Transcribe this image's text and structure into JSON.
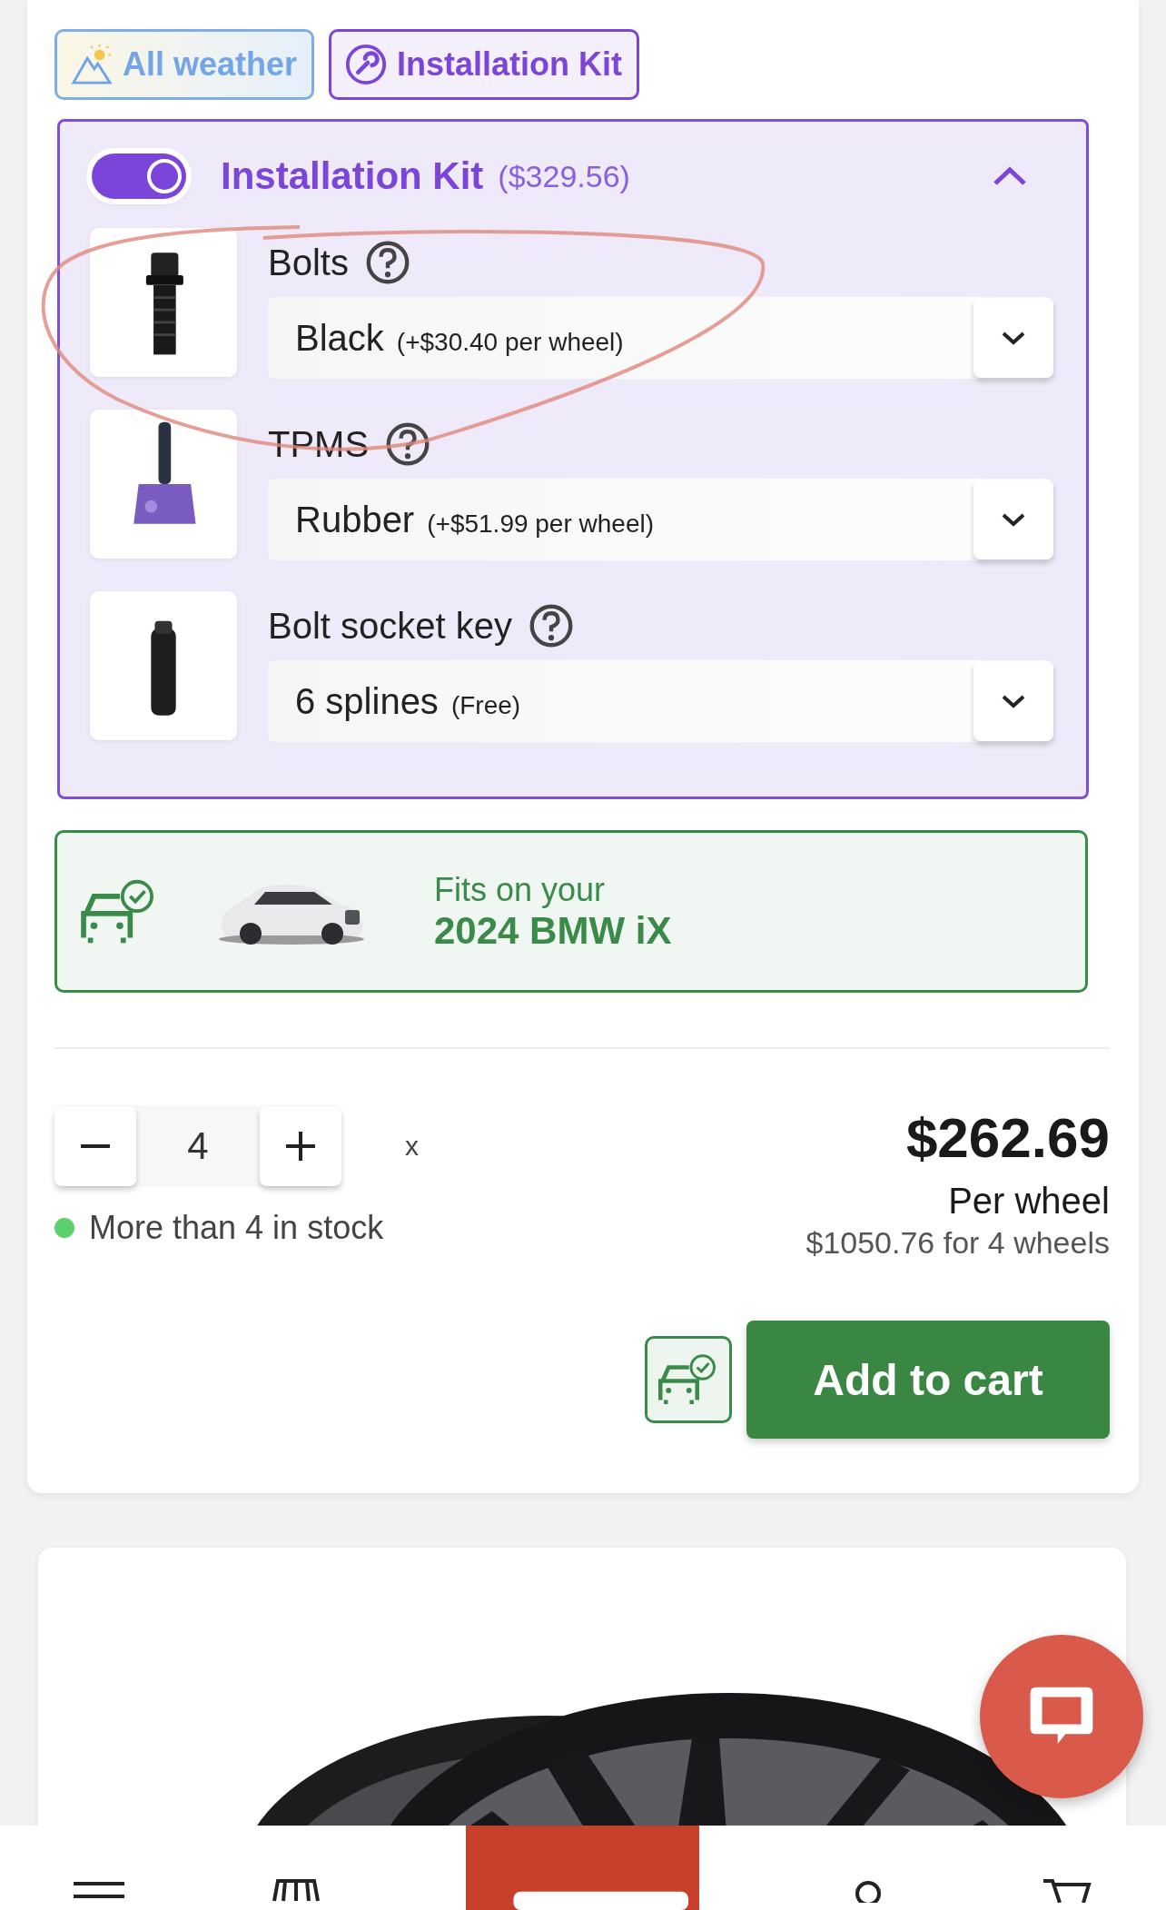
{
  "tags": [
    {
      "label": "All weather",
      "kind": "weather"
    },
    {
      "label": "Installation Kit",
      "kind": "kit"
    }
  ],
  "kit": {
    "title": "Installation Kit",
    "price": "($329.56)",
    "enabled": true,
    "expanded": true,
    "options": [
      {
        "label": "Bolts",
        "value": "Black",
        "note": "(+$30.40 per wheel)",
        "kind": "bolt"
      },
      {
        "label": "TPMS",
        "value": "Rubber",
        "note": "(+$51.99 per wheel)",
        "kind": "tpms"
      },
      {
        "label": "Bolt socket key",
        "value": "6 splines",
        "note": "(Free)",
        "kind": "key"
      }
    ]
  },
  "fitment": {
    "intro": "Fits on your",
    "vehicle": "2024 BMW iX"
  },
  "quantity": {
    "value": "4",
    "times": "x"
  },
  "stock": {
    "text": "More than 4 in stock",
    "color": "#5ccf6f"
  },
  "price": {
    "amount": "$262.69",
    "unit": "Per wheel",
    "total": "$1050.76 for 4 wheels"
  },
  "add_to_cart": "Add to cart"
}
